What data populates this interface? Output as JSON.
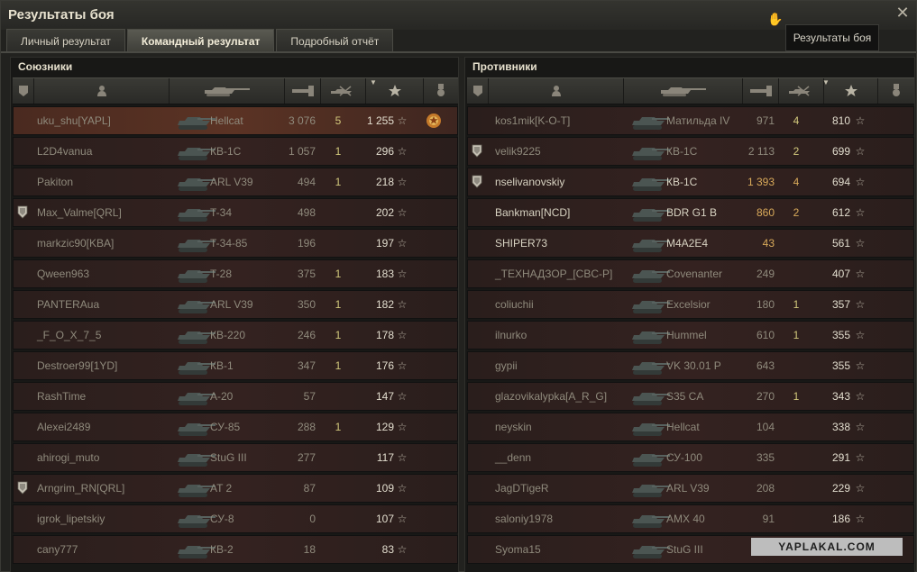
{
  "window": {
    "title": "Результаты боя",
    "tooltip": "Результаты боя"
  },
  "tabs": [
    {
      "label": "Личный результат",
      "active": false
    },
    {
      "label": "Командный результат",
      "active": true
    },
    {
      "label": "Подробный отчёт",
      "active": false
    }
  ],
  "header_icons": [
    "badge-icon",
    "player-icon",
    "tank-icon",
    "damage-icon",
    "frags-icon",
    "sort-caret-icon",
    "star-icon",
    "medal-icon"
  ],
  "allies": {
    "title": "Союзники",
    "rows": [
      {
        "name": "uku_shu[YAPL]",
        "vehicle": "Hellcat",
        "damage": "3 076",
        "frags": "5",
        "xp": "1 255",
        "badge": false,
        "medal": true,
        "me": true
      },
      {
        "name": "L2D4vanua",
        "vehicle": "КВ-1С",
        "damage": "1 057",
        "frags": "1",
        "xp": "296",
        "badge": false,
        "medal": false
      },
      {
        "name": "Pakiton",
        "vehicle": "ARL V39",
        "damage": "494",
        "frags": "1",
        "xp": "218",
        "badge": false,
        "medal": false
      },
      {
        "name": "Max_Valme[QRL]",
        "vehicle": "T-34",
        "damage": "498",
        "frags": "",
        "xp": "202",
        "badge": true,
        "medal": false
      },
      {
        "name": "markzic90[KBA]",
        "vehicle": "T-34-85",
        "damage": "196",
        "frags": "",
        "xp": "197",
        "badge": false,
        "medal": false
      },
      {
        "name": "Qween963",
        "vehicle": "T-28",
        "damage": "375",
        "frags": "1",
        "xp": "183",
        "badge": false,
        "medal": false
      },
      {
        "name": "PANTERAua",
        "vehicle": "ARL V39",
        "damage": "350",
        "frags": "1",
        "xp": "182",
        "badge": false,
        "medal": false
      },
      {
        "name": "_F_O_X_7_5",
        "vehicle": "КВ-220",
        "damage": "246",
        "frags": "1",
        "xp": "178",
        "badge": false,
        "medal": false
      },
      {
        "name": "Destroer99[1YD]",
        "vehicle": "КВ-1",
        "damage": "347",
        "frags": "1",
        "xp": "176",
        "badge": false,
        "medal": false
      },
      {
        "name": "RashTime",
        "vehicle": "А-20",
        "damage": "57",
        "frags": "",
        "xp": "147",
        "badge": false,
        "medal": false
      },
      {
        "name": "Alexei2489",
        "vehicle": "СУ-85",
        "damage": "288",
        "frags": "1",
        "xp": "129",
        "badge": false,
        "medal": false
      },
      {
        "name": "ahirogi_muto",
        "vehicle": "StuG III",
        "damage": "277",
        "frags": "",
        "xp": "117",
        "badge": false,
        "medal": false
      },
      {
        "name": "Arngrim_RN[QRL]",
        "vehicle": "AT 2",
        "damage": "87",
        "frags": "",
        "xp": "109",
        "badge": true,
        "medal": false
      },
      {
        "name": "igrok_lipetskiy",
        "vehicle": "СУ-8",
        "damage": "0",
        "frags": "",
        "xp": "107",
        "badge": false,
        "medal": false
      },
      {
        "name": "cany777",
        "vehicle": "КВ-2",
        "damage": "18",
        "frags": "",
        "xp": "83",
        "badge": false,
        "medal": false
      }
    ]
  },
  "enemies": {
    "title": "Противники",
    "rows": [
      {
        "name": "kos1mik[K-O-T]",
        "vehicle": "Матильда IV",
        "damage": "971",
        "frags": "4",
        "xp": "810",
        "badge": false,
        "bright": false
      },
      {
        "name": "velik9225",
        "vehicle": "КВ-1С",
        "damage": "2 113",
        "frags": "2",
        "xp": "699",
        "badge": true,
        "bright": false
      },
      {
        "name": "nselivanovskiy",
        "vehicle": "КВ-1С",
        "damage": "1 393",
        "frags": "4",
        "xp": "694",
        "badge": true,
        "bright": true
      },
      {
        "name": "Bankman[NCD]",
        "vehicle": "BDR G1 B",
        "damage": "860",
        "frags": "2",
        "xp": "612",
        "badge": false,
        "bright": true
      },
      {
        "name": "SHIPER73",
        "vehicle": "M4A2E4",
        "damage": "43",
        "frags": "",
        "xp": "561",
        "badge": false,
        "bright": true
      },
      {
        "name": "_ТЕХНАДЗОР_[CBC-P]",
        "vehicle": "Covenanter",
        "damage": "249",
        "frags": "",
        "xp": "407",
        "badge": false,
        "bright": false
      },
      {
        "name": "coliuchii",
        "vehicle": "Excelsior",
        "damage": "180",
        "frags": "1",
        "xp": "357",
        "badge": false,
        "bright": false
      },
      {
        "name": "ilnurko",
        "vehicle": "Hummel",
        "damage": "610",
        "frags": "1",
        "xp": "355",
        "badge": false,
        "bright": false
      },
      {
        "name": "gypii",
        "vehicle": "VK 30.01 P",
        "damage": "643",
        "frags": "",
        "xp": "355",
        "badge": false,
        "bright": false
      },
      {
        "name": "glazovikalypka[A_R_G]",
        "vehicle": "S35 CA",
        "damage": "270",
        "frags": "1",
        "xp": "343",
        "badge": false,
        "bright": false
      },
      {
        "name": "neyskin",
        "vehicle": "Hellcat",
        "damage": "104",
        "frags": "",
        "xp": "338",
        "badge": false,
        "bright": false
      },
      {
        "name": "__denn",
        "vehicle": "СУ-100",
        "damage": "335",
        "frags": "",
        "xp": "291",
        "badge": false,
        "bright": false
      },
      {
        "name": "JagDTigeR",
        "vehicle": "ARL V39",
        "damage": "208",
        "frags": "",
        "xp": "229",
        "badge": false,
        "bright": false
      },
      {
        "name": "saloniy1978",
        "vehicle": "AMX 40",
        "damage": "91",
        "frags": "",
        "xp": "186",
        "badge": false,
        "bright": false
      },
      {
        "name": "Syoma15",
        "vehicle": "StuG III",
        "damage": "0",
        "frags": "",
        "xp": "165",
        "badge": false,
        "bright": false
      }
    ]
  },
  "watermark": "YAPLAKAL.COM",
  "colors": {
    "accent": "#d8a95a",
    "frags": "#d2c87c",
    "row_bg": "#342220",
    "me_row_bg": "#5b3324"
  }
}
